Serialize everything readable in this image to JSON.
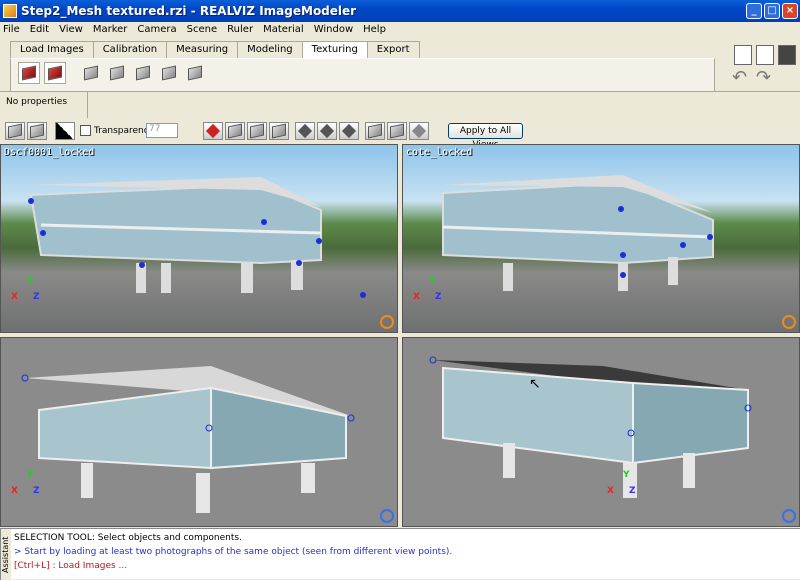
{
  "window": {
    "title": "Step2_Mesh textured.rzi - REALVIZ ImageModeler"
  },
  "menu": [
    "File",
    "Edit",
    "View",
    "Marker",
    "Camera",
    "Scene",
    "Ruler",
    "Material",
    "Window",
    "Help"
  ],
  "tabs": [
    "Load Images",
    "Calibration",
    "Measuring",
    "Modeling",
    "Texturing",
    "Export"
  ],
  "active_tab": "Texturing",
  "properties": {
    "text": "No properties"
  },
  "toolbar2": {
    "transparency_label": "Transparency",
    "transparency_value": "77",
    "apply_label": "Apply to All Views"
  },
  "views": [
    {
      "label": "Dscf0001_locked",
      "kind": "photo"
    },
    {
      "label": "cote_locked",
      "kind": "photo"
    },
    {
      "label": "",
      "kind": "render"
    },
    {
      "label": "",
      "kind": "render"
    }
  ],
  "axes": {
    "x": "X",
    "y": "Y",
    "z": "Z"
  },
  "console": {
    "tab_label": "Assistant",
    "line1": "SELECTION TOOL: Select objects and components.",
    "line2": "> Start by loading at least two photographs of the same object (seen from different view points).",
    "line3": "[Ctrl+L] : Load Images ..."
  },
  "colors": {
    "accent_title": "#0047c8",
    "console_link": "#2233cc",
    "console_cmd": "#c01818",
    "marker": "#1b2fd8"
  }
}
